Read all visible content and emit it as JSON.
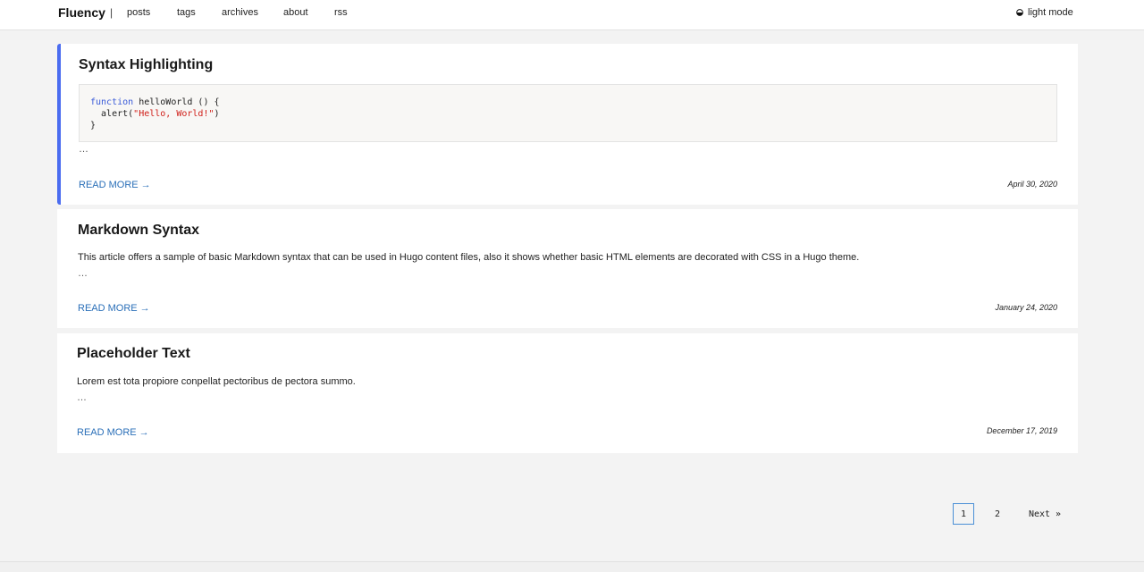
{
  "header": {
    "brand": "Fluency",
    "separator": "|",
    "nav": [
      {
        "label": "posts"
      },
      {
        "label": "tags"
      },
      {
        "label": "archives"
      },
      {
        "label": "about"
      },
      {
        "label": "rss"
      }
    ],
    "mode_toggle": {
      "icon": "half-circle-icon",
      "label": "light mode"
    }
  },
  "posts": [
    {
      "title": "Syntax Highlighting",
      "code": {
        "line1_keyword": "function",
        "line1_rest": " helloWorld () {",
        "line2_prefix": "  alert(",
        "line2_string": "\"Hello, World!\"",
        "line2_suffix": ")",
        "line3": "}"
      },
      "ellipsis": "…",
      "read_more": "READ MORE →",
      "date": "April 30, 2020",
      "accent_color": "#4a6cf0"
    },
    {
      "title": "Markdown Syntax",
      "summary": "This article offers a sample of basic Markdown syntax that can be used in Hugo content files, also it shows whether basic HTML elements are decorated with CSS in a Hugo theme.",
      "ellipsis": "…",
      "read_more": "READ MORE →",
      "date": "January 24, 2020"
    },
    {
      "title": "Placeholder Text",
      "summary": "Lorem est tota propiore conpellat pectoribus de pectora summo.",
      "ellipsis": "…",
      "read_more": "READ MORE →",
      "date": "December 17, 2019"
    }
  ],
  "pagination": {
    "pages": [
      "1",
      "2"
    ],
    "current": "1",
    "next_label": "Next »"
  },
  "colors": {
    "link": "#2a6fb8",
    "accent": "#4a6cf0",
    "code_keyword": "#3a5bd9",
    "code_string": "#d0201a"
  }
}
